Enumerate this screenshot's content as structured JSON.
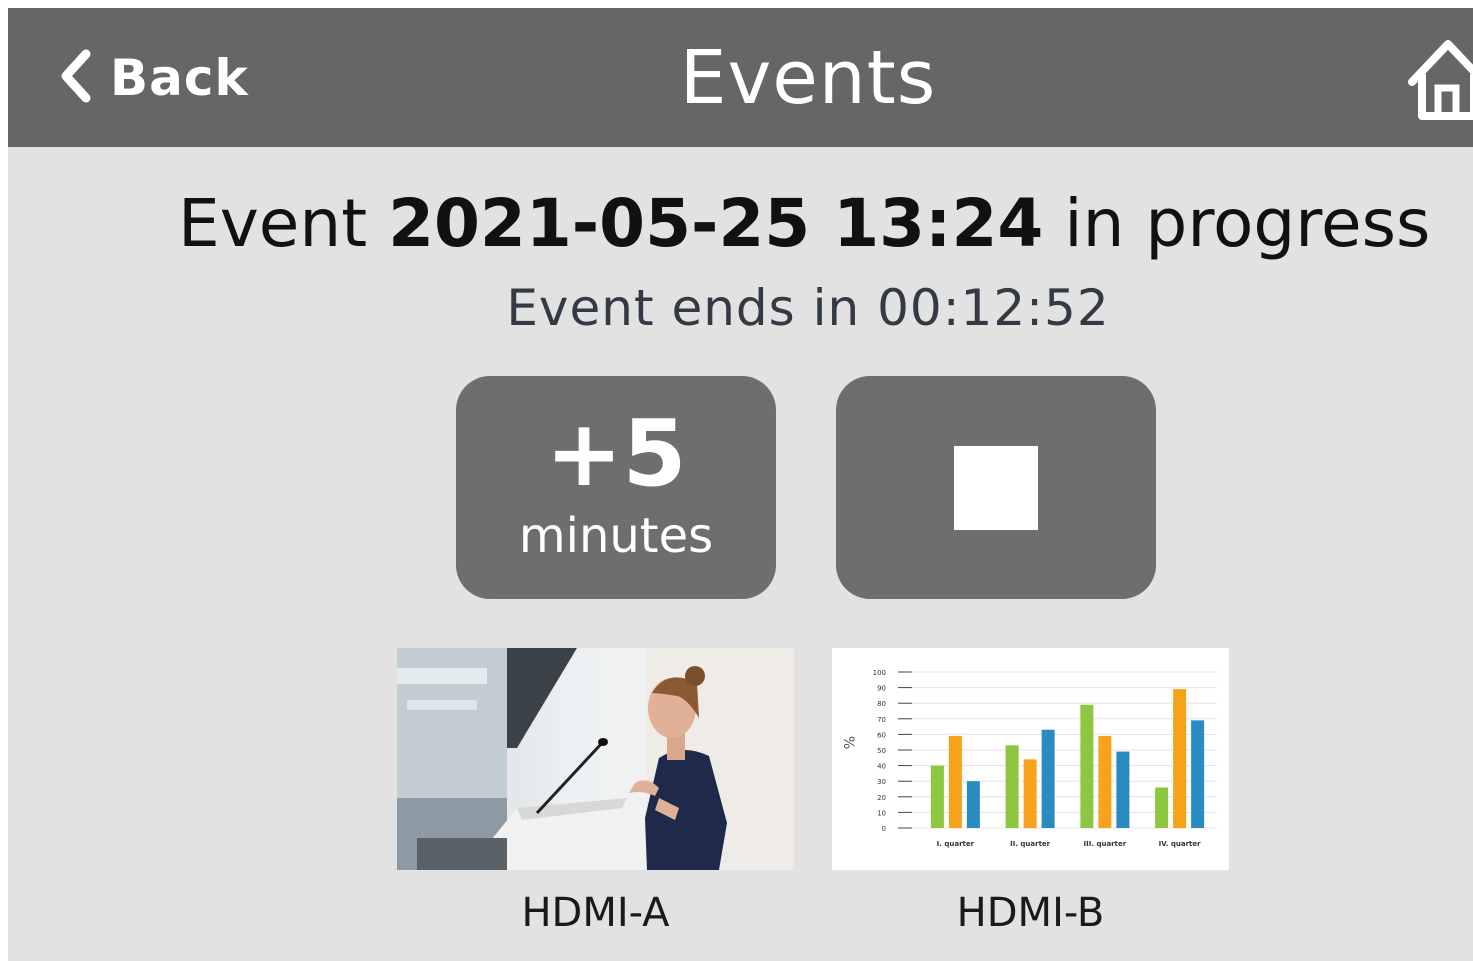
{
  "header": {
    "back_label": "Back",
    "title": "Events",
    "icons": {
      "back": "chevron-left-icon",
      "home": "home-icon"
    }
  },
  "event": {
    "prefix": "Event",
    "datetime": "2021-05-25 13:24",
    "status": "in progress",
    "ends_text": "Event ends in 00:12:52"
  },
  "controls": {
    "extend_value": "+5",
    "extend_unit": "minutes",
    "stop_icon": "stop-icon"
  },
  "sources": [
    {
      "label": "HDMI-A",
      "thumbnail": "speaker-at-podium-photo"
    },
    {
      "label": "HDMI-B",
      "thumbnail": "bar-chart-preview"
    }
  ],
  "chart_data": {
    "type": "bar",
    "ylabel": "%",
    "ylim": [
      0,
      100
    ],
    "yticks": [
      "0",
      "10",
      "20",
      "30",
      "40",
      "50",
      "60",
      "70",
      "80",
      "90",
      "100"
    ],
    "categories": [
      "I. quarter",
      "II. quarter",
      "III. quarter",
      "IV. quarter"
    ],
    "series": [
      {
        "color": "#8dc63f",
        "values": [
          40,
          53,
          79,
          26
        ]
      },
      {
        "color": "#f7a21b",
        "values": [
          59,
          44,
          59,
          89
        ]
      },
      {
        "color": "#2a8bc2",
        "values": [
          30,
          63,
          49,
          69
        ]
      }
    ]
  }
}
